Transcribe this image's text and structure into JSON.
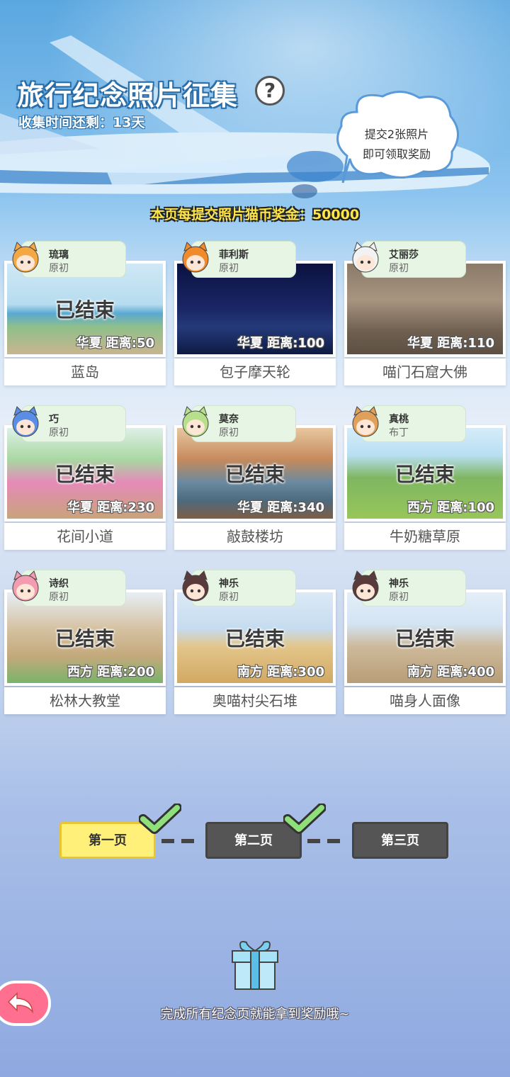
{
  "header": {
    "title": "旅行纪念照片征集",
    "help_icon": "?",
    "countdown": "收集时间还剩：13天"
  },
  "bubble": {
    "line1": "提交2张照片",
    "line2": "即可领取奖励"
  },
  "bonus_text": "本页每提交照片猫币奖金：50000",
  "cards": [
    {
      "name": "琉璃",
      "version": "原初",
      "status": "已结束",
      "distance": "华夏  距离:50",
      "place": "蓝岛",
      "scene": "coast"
    },
    {
      "name": "菲利斯",
      "version": "原初",
      "status": "",
      "distance": "华夏  距离:100",
      "place": "包子摩天轮",
      "scene": "night"
    },
    {
      "name": "艾丽莎",
      "version": "原初",
      "status": "",
      "distance": "华夏  距离:110",
      "place": "喵门石窟大佛",
      "scene": "cave"
    },
    {
      "name": "巧",
      "version": "原初",
      "status": "已结束",
      "distance": "华夏  距离:230",
      "place": "花间小道",
      "scene": "flowers"
    },
    {
      "name": "莫奈",
      "version": "原初",
      "status": "已结束",
      "distance": "华夏  距离:340",
      "place": "敲鼓楼坊",
      "scene": "lake"
    },
    {
      "name": "真桃",
      "version": "布丁",
      "status": "已结束",
      "distance": "西方  距离:100",
      "place": "牛奶糖草原",
      "scene": "meadow"
    },
    {
      "name": "诗织",
      "version": "原初",
      "status": "已结束",
      "distance": "西方  距离:200",
      "place": "松林大教堂",
      "scene": "cathedral"
    },
    {
      "name": "神乐",
      "version": "原初",
      "status": "已结束",
      "distance": "南方  距离:300",
      "place": "奥喵村尖石堆",
      "scene": "desert"
    },
    {
      "name": "神乐",
      "version": "原初",
      "status": "已结束",
      "distance": "南方  距离:400",
      "place": "喵身人面像",
      "scene": "sphinx"
    }
  ],
  "pages": [
    {
      "label": "第一页",
      "state": "active",
      "done": true
    },
    {
      "label": "第二页",
      "state": "inactive",
      "done": true
    },
    {
      "label": "第三页",
      "state": "inactive",
      "done": false
    }
  ],
  "footer_text": "完成所有纪念页就能拿到奖励哦~",
  "icons": {
    "gift": "gift-icon",
    "back": "back-arrow-icon",
    "check": "checkmark-icon",
    "help": "question-icon"
  },
  "colors": {
    "active_page": "#fff07a",
    "inactive_page": "#555555",
    "bonus_text": "#ffe648",
    "tag_bg": "#e7f6e4",
    "back_button": "#ff6f8f"
  }
}
